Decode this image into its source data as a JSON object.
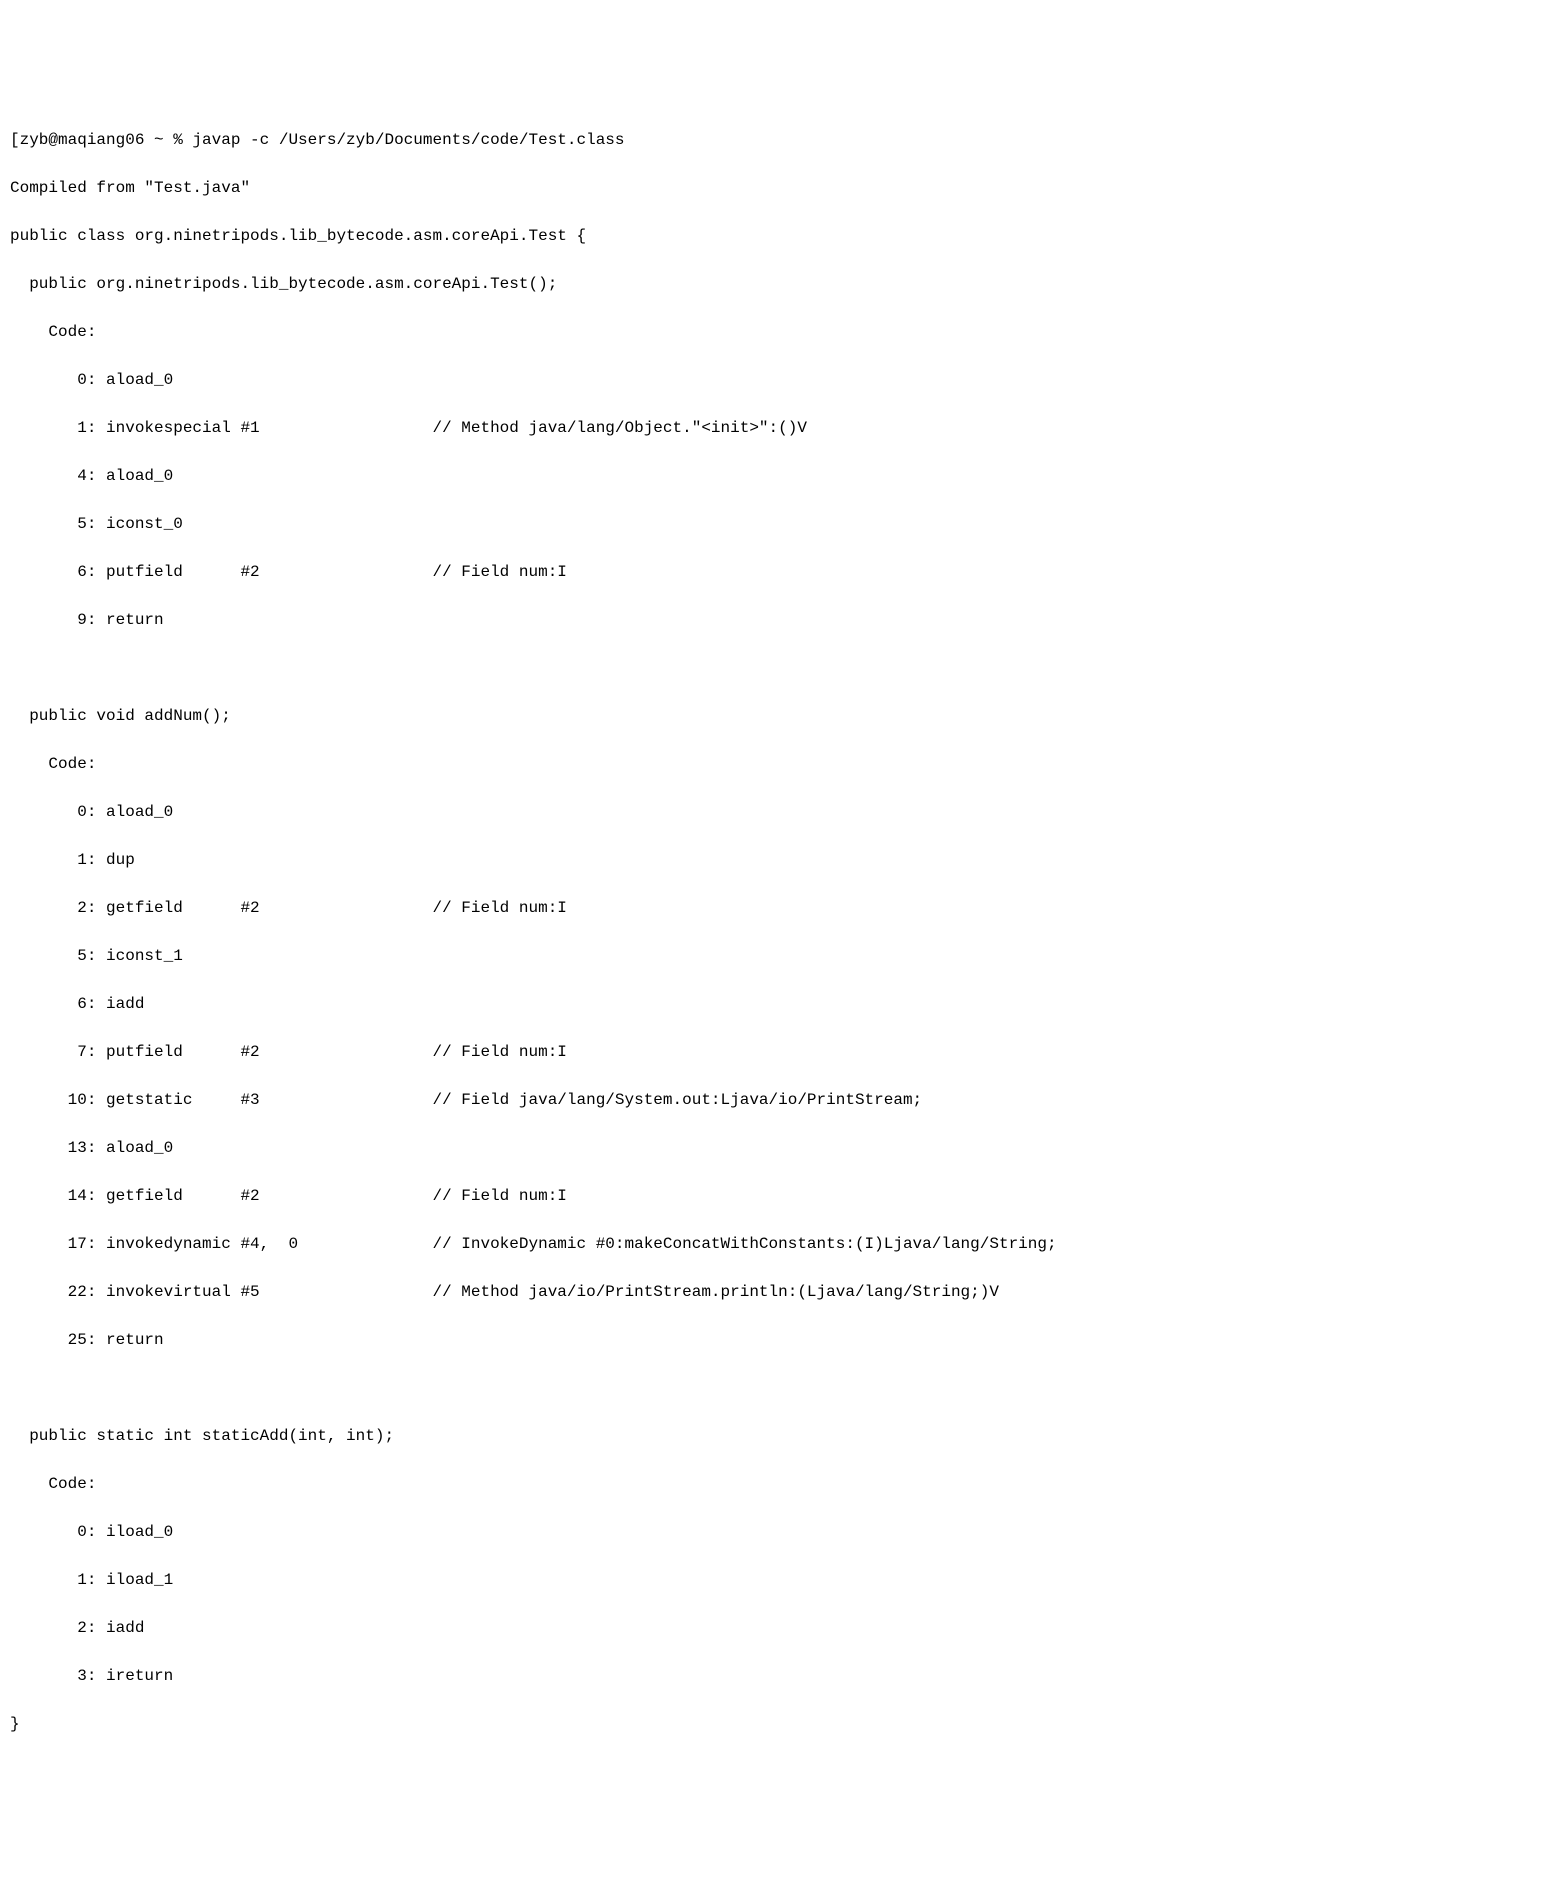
{
  "prompt_line": "[zyb@maqiang06 ~ % javap -c /Users/zyb/Documents/code/Test.class",
  "compiled_from": "Compiled from \"Test.java\"",
  "class_decl": "public class org.ninetripods.lib_bytecode.asm.coreApi.Test {",
  "constructor": {
    "signature": "  public org.ninetripods.lib_bytecode.asm.coreApi.Test();",
    "code_label": "    Code:",
    "instructions": [
      "       0: aload_0",
      "       1: invokespecial #1                  // Method java/lang/Object.\"<init>\":()V",
      "       4: aload_0",
      "       5: iconst_0",
      "       6: putfield      #2                  // Field num:I",
      "       9: return"
    ]
  },
  "addNum": {
    "signature": "  public void addNum();",
    "code_label": "    Code:",
    "instructions": [
      "       0: aload_0",
      "       1: dup",
      "       2: getfield      #2                  // Field num:I",
      "       5: iconst_1",
      "       6: iadd",
      "       7: putfield      #2                  // Field num:I",
      "      10: getstatic     #3                  // Field java/lang/System.out:Ljava/io/PrintStream;",
      "      13: aload_0",
      "      14: getfield      #2                  // Field num:I",
      "      17: invokedynamic #4,  0              // InvokeDynamic #0:makeConcatWithConstants:(I)Ljava/lang/String;",
      "      22: invokevirtual #5                  // Method java/io/PrintStream.println:(Ljava/lang/String;)V",
      "      25: return"
    ]
  },
  "staticAdd": {
    "signature": "  public static int staticAdd(int, int);",
    "code_label": "    Code:",
    "instructions": [
      "       0: iload_0",
      "       1: iload_1",
      "       2: iadd",
      "       3: ireturn"
    ]
  },
  "class_close": "}"
}
